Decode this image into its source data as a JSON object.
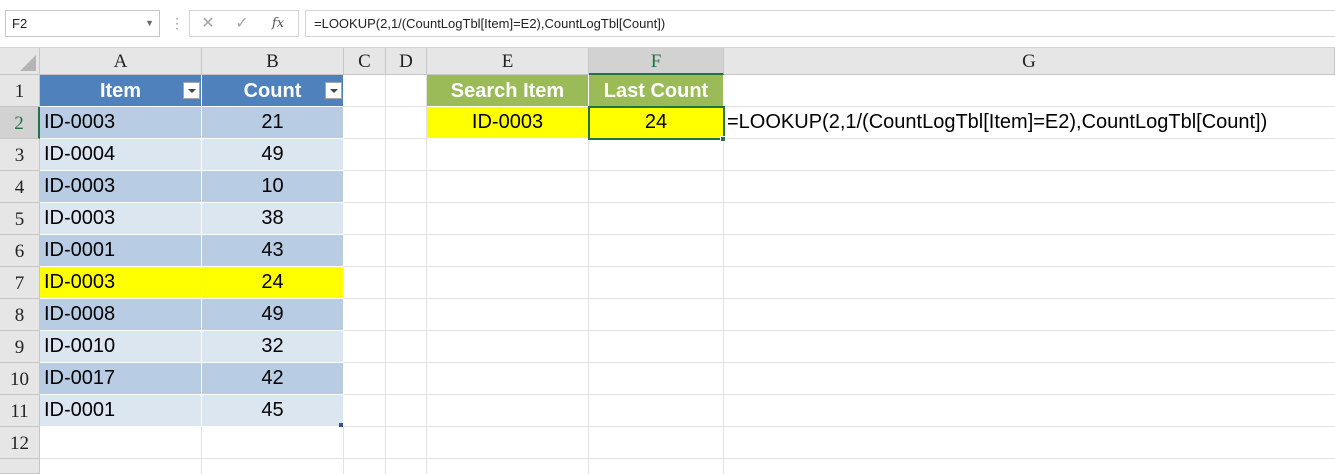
{
  "name_box": {
    "value": "F2"
  },
  "formula_bar": {
    "formula": "=LOOKUP(2,1/(CountLogTbl[Item]=E2),CountLogTbl[Count])",
    "fx_label": "fx"
  },
  "columns": [
    "A",
    "B",
    "C",
    "D",
    "E",
    "F",
    "G"
  ],
  "rows": [
    "1",
    "2",
    "3",
    "4",
    "5",
    "6",
    "7",
    "8",
    "9",
    "10",
    "11",
    "12"
  ],
  "table": {
    "headers": {
      "item": "Item",
      "count": "Count"
    },
    "rows": [
      {
        "item": "ID-0003",
        "count": "21"
      },
      {
        "item": "ID-0004",
        "count": "49"
      },
      {
        "item": "ID-0003",
        "count": "10"
      },
      {
        "item": "ID-0003",
        "count": "38"
      },
      {
        "item": "ID-0001",
        "count": "43"
      },
      {
        "item": "ID-0003",
        "count": "24"
      },
      {
        "item": "ID-0008",
        "count": "49"
      },
      {
        "item": "ID-0010",
        "count": "32"
      },
      {
        "item": "ID-0017",
        "count": "42"
      },
      {
        "item": "ID-0001",
        "count": "45"
      }
    ]
  },
  "lookup": {
    "search_header": "Search Item",
    "last_count_header": "Last Count",
    "search_value": "ID-0003",
    "last_count_value": "24",
    "formula_display": "=LOOKUP(2,1/(CountLogTbl[Item]=E2),CountLogTbl[Count])"
  },
  "colors": {
    "table_header": "#4f81bd",
    "band_dark": "#b8cce4",
    "band_light": "#dce6f1",
    "highlight": "#ffff00",
    "green_header": "#9bbb59",
    "selection": "#217346"
  }
}
